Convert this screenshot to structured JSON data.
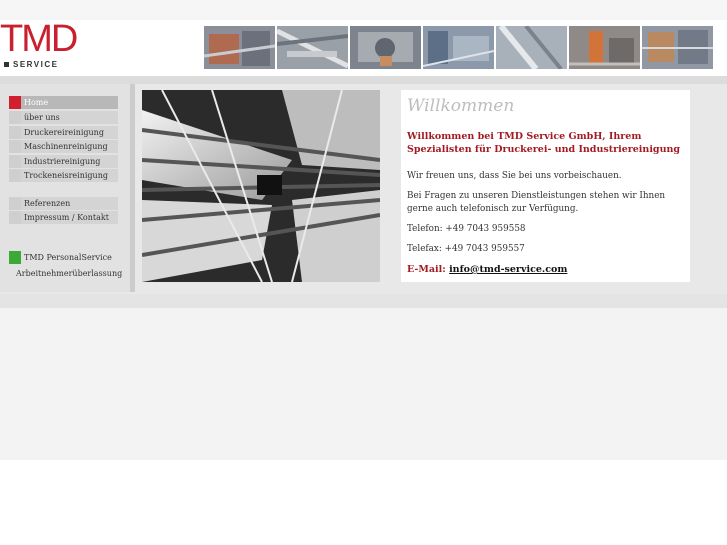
{
  "logo": {
    "text": "TMD",
    "subtext": "SERVICE"
  },
  "header": {
    "photos": [
      "industrial-photo-1",
      "industrial-photo-2",
      "industrial-photo-3",
      "industrial-photo-4",
      "industrial-photo-5",
      "industrial-photo-6",
      "industrial-photo-7"
    ]
  },
  "nav": {
    "items": [
      {
        "label": "Home"
      },
      {
        "label": "über uns"
      },
      {
        "label": "Druckereireinigung"
      },
      {
        "label": "Maschinenreinigung"
      },
      {
        "label": "Industriereinigung"
      },
      {
        "label": "Trockeneisreinigung"
      },
      {
        "label": "Referenzen"
      },
      {
        "label": "Impressum / Kontakt"
      },
      {
        "label": "TMD PersonalService"
      }
    ],
    "arbeit": "Arbeitnehmerüberlassung"
  },
  "welcome": {
    "title": "Willkommen",
    "headline": "Willkommen bei TMD Service GmbH, Ihrem Spezialisten für Druckerei- und Industriereinigung",
    "p1": "Wir freuen uns, dass Sie bei uns vorbeischauen.",
    "p2": "Bei Fragen zu unseren Dienstleistungen stehen wir Ihnen gerne auch telefonisch zur Verfügung.",
    "phone": "Telefon: +49 7043 959558",
    "fax": "Telefax: +49 7043 959557",
    "email_label": "E-Mail:",
    "email": "info@tmd-service.com"
  },
  "colors": {
    "brand_red": "#c8202f",
    "accent_green": "#3aaa35",
    "headline_red": "#a31a22"
  }
}
